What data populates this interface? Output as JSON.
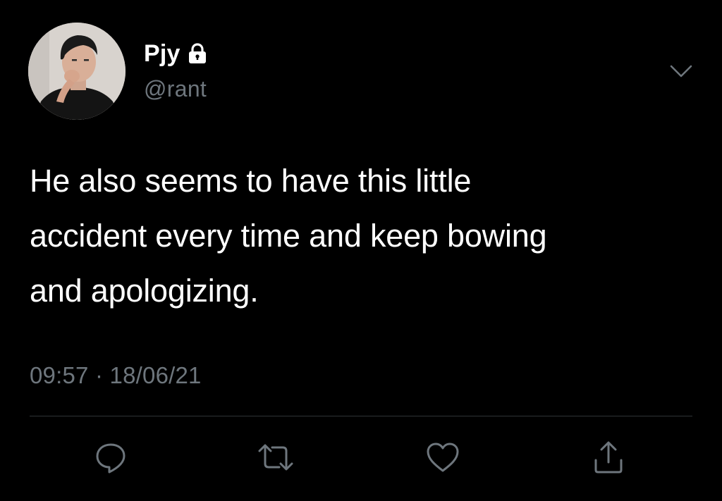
{
  "user": {
    "display_name": "Pjy",
    "handle": "@rant",
    "avatar": "user-avatar",
    "protected_icon": "lock-icon"
  },
  "tweet": {
    "text": "He also seems to have this little\naccident every time and keep bowing\nand apologizing.",
    "time": "09:57",
    "separator": "·",
    "date": "18/06/21"
  },
  "menu_icon": "chevron-down-icon",
  "actions": [
    {
      "name": "reply",
      "icon": "speech-bubble-icon"
    },
    {
      "name": "retweet",
      "icon": "retweet-icon"
    },
    {
      "name": "like",
      "icon": "heart-icon"
    },
    {
      "name": "share",
      "icon": "share-icon"
    }
  ],
  "colors": {
    "background": "#000000",
    "primary_text": "#ffffff",
    "secondary_text": "#6e767d",
    "divider": "#2f3336"
  }
}
